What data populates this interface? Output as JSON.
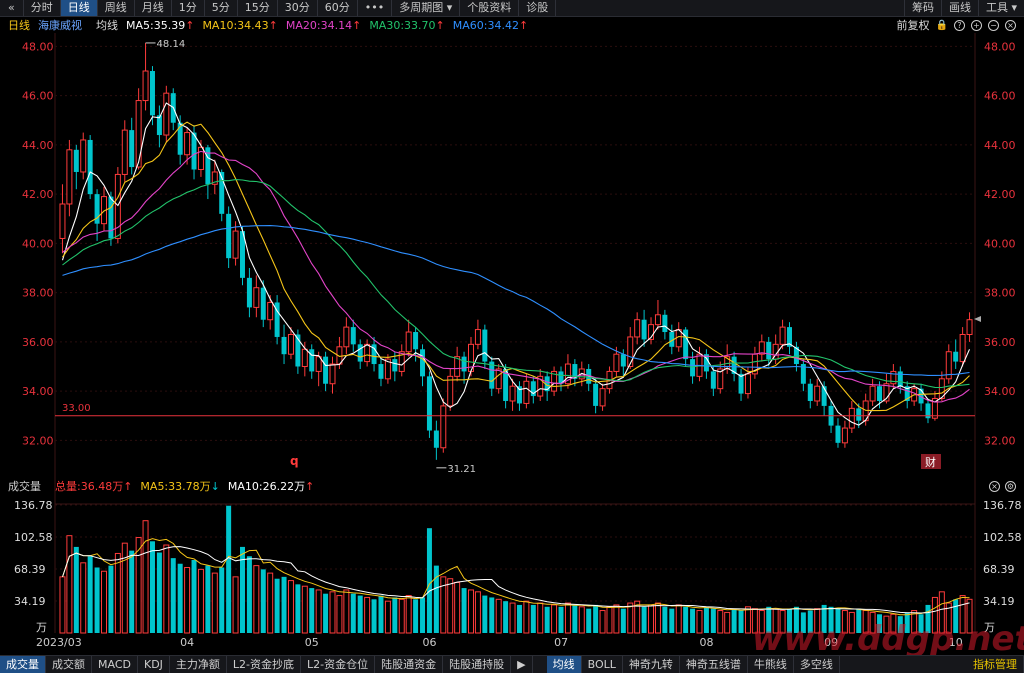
{
  "toolbar": {
    "back_icon": "«",
    "periods": [
      "分时",
      "日线",
      "周线",
      "月线",
      "1分",
      "5分",
      "15分",
      "30分",
      "60分"
    ],
    "active_period": "日线",
    "more": "•••",
    "multi_period": "多周期图",
    "stock_info": "个股资料",
    "diagnose": "诊股",
    "right": [
      "筹码",
      "画线",
      "工具"
    ]
  },
  "header": {
    "period_label": "日线",
    "stock_name": "海康威视",
    "ma_label": "均线",
    "ma5": "MA5:35.39",
    "ma10": "MA10:34.43",
    "ma20": "MA20:34.14",
    "ma30": "MA30:33.70",
    "ma60": "MA60:34.42",
    "adjust": "前复权"
  },
  "colors": {
    "up": "#ff3b3b",
    "down": "#00c5cd",
    "ma5": "#ffffff",
    "ma10": "#f5c518",
    "ma20": "#e244c8",
    "ma30": "#22c36b",
    "ma60": "#2f8fff",
    "support": "#e8323c",
    "axis_text": "#e8323c",
    "grid": "#2b0e0e"
  },
  "volume_header": {
    "label": "成交量",
    "total": "总量:36.48万",
    "ma5": "MA5:33.78万",
    "ma10": "MA10:26.22万"
  },
  "chart_data": {
    "type": "candlestick",
    "price_ticks": [
      "48.00",
      "46.00",
      "44.00",
      "42.00",
      "40.00",
      "38.00",
      "36.00",
      "34.00",
      "32.00"
    ],
    "ylim": [
      31.0,
      48.3
    ],
    "support_line": {
      "value": 33.0,
      "label": "33.00"
    },
    "max_marker": {
      "value": 48.14,
      "label": "48.14"
    },
    "min_marker": {
      "value": 31.21,
      "label": "31.21"
    },
    "markers": [
      "q",
      "财"
    ],
    "x_labels": [
      "2023/03",
      "04",
      "05",
      "06",
      "07",
      "08",
      "09",
      "10"
    ],
    "volume_ticks": [
      "136.78",
      "102.58",
      "68.39",
      "34.19",
      "万"
    ],
    "volume_ylim": [
      0,
      136.78
    ],
    "unit": "万"
  },
  "volume_ma_tags": [
    "MA5",
    "MA10"
  ],
  "bottom": {
    "left": [
      "成交量",
      "成交额",
      "MACD",
      "KDJ",
      "主力净额",
      "L2-资金抄底",
      "L2-资金仓位",
      "陆股通资金",
      "陆股通持股"
    ],
    "arrow": "▶",
    "right": [
      "均线",
      "BOLL",
      "神奇九转",
      "神奇五线谱",
      "牛熊线",
      "多空线"
    ],
    "manage": "指标管理"
  },
  "watermark": "www.ddgp.net"
}
